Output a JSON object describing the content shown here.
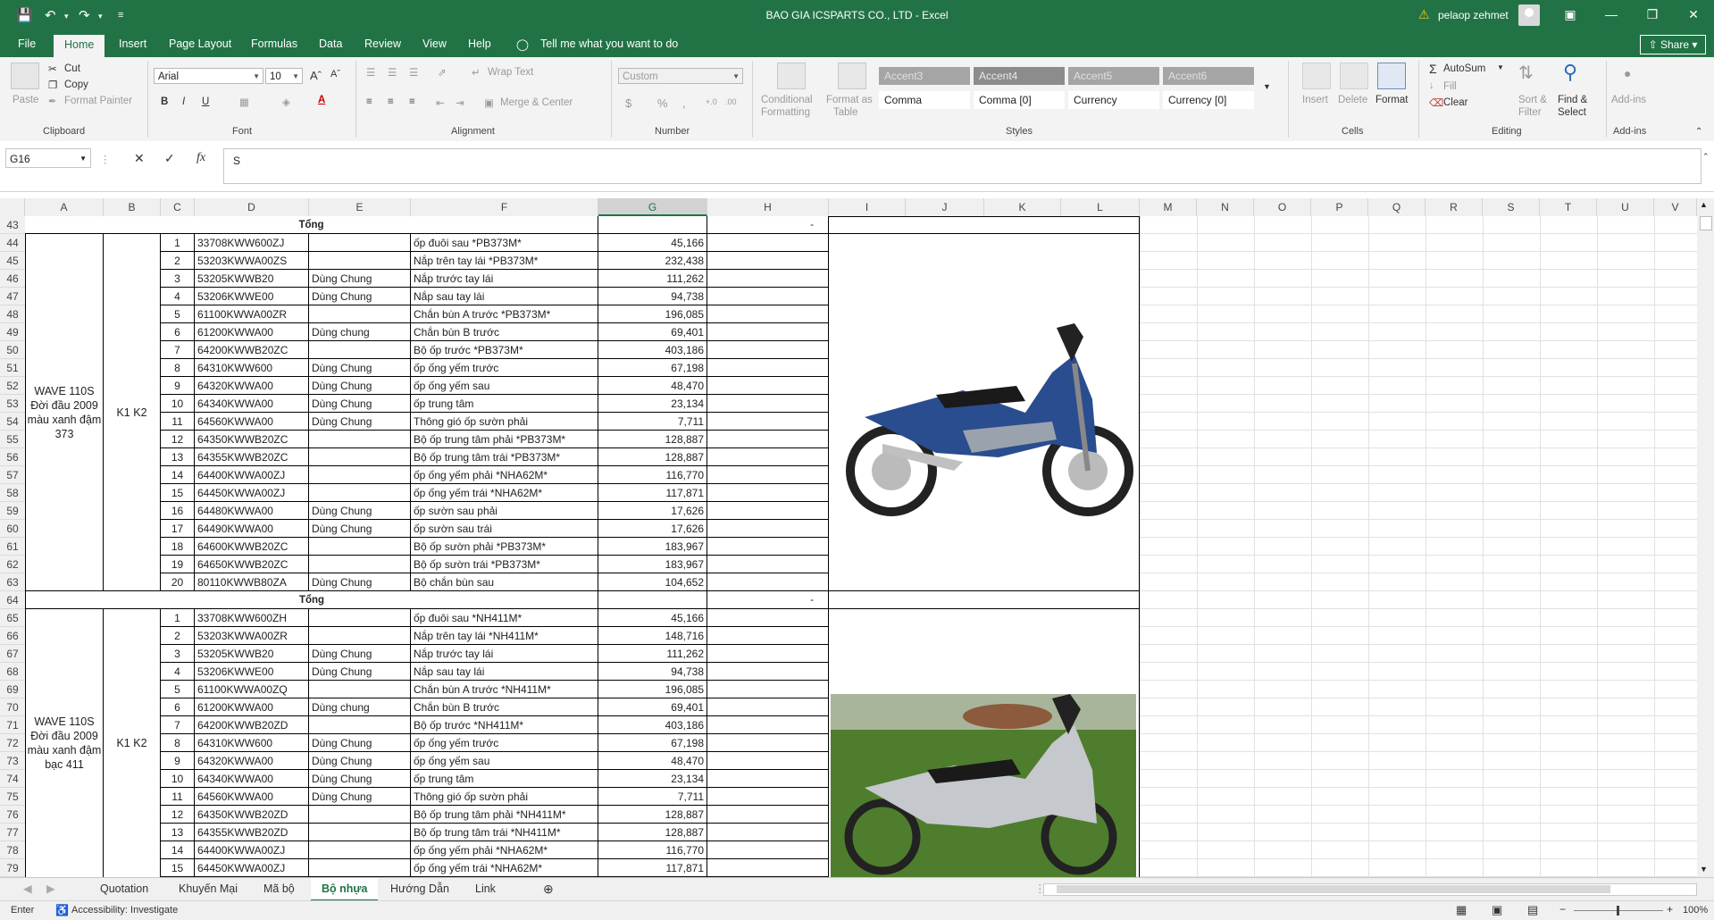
{
  "window": {
    "title": "BAO GIA ICSPARTS CO., LTD  -  Excel",
    "user": "pelaop zehmet"
  },
  "ribbon_tabs": [
    "File",
    "Home",
    "Insert",
    "Page Layout",
    "Formulas",
    "Data",
    "Review",
    "View",
    "Help",
    "Tell me what you want to do"
  ],
  "share_label": "Share",
  "clipboard": {
    "paste": "Paste",
    "cut": "Cut",
    "copy": "Copy",
    "format_painter": "Format Painter",
    "label": "Clipboard"
  },
  "font": {
    "name": "Arial",
    "size": "10",
    "label": "Font"
  },
  "alignment": {
    "wrap": "Wrap Text",
    "merge": "Merge & Center",
    "label": "Alignment"
  },
  "number": {
    "format": "Custom",
    "label": "Number"
  },
  "styles": {
    "cond1": "Conditional",
    "cond2": "Formatting",
    "fmt1": "Format as",
    "fmt2": "Table",
    "cells": [
      "Accent3",
      "Accent4",
      "Accent5",
      "Accent6",
      "Comma",
      "Comma [0]",
      "Currency",
      "Currency [0]"
    ],
    "label": "Styles"
  },
  "cells_group": {
    "insert": "Insert",
    "delete": "Delete",
    "format": "Format",
    "label": "Cells"
  },
  "editing": {
    "autosum": "AutoSum",
    "fill": "Fill",
    "clear": "Clear",
    "sort1": "Sort &",
    "sort2": "Filter",
    "find1": "Find &",
    "find2": "Select",
    "label": "Editing"
  },
  "addins": {
    "btn": "Add-ins",
    "label": "Add-ins"
  },
  "formula_bar": {
    "name_box": "G16",
    "content": "S"
  },
  "columns": [
    "A",
    "B",
    "C",
    "D",
    "E",
    "F",
    "G",
    "H",
    "I",
    "J",
    "K",
    "L",
    "M",
    "N",
    "O",
    "P",
    "Q",
    "R",
    "S",
    "T",
    "U",
    "V"
  ],
  "rows": [
    "43",
    "44",
    "45",
    "46",
    "47",
    "48",
    "49",
    "50",
    "51",
    "52",
    "53",
    "54",
    "55",
    "56",
    "57",
    "58",
    "59",
    "60",
    "61",
    "62",
    "63",
    "64",
    "65",
    "66",
    "67",
    "68",
    "69",
    "70",
    "71",
    "72",
    "73",
    "74",
    "75",
    "76",
    "77",
    "78",
    "79"
  ],
  "total_label": "Tổng",
  "total_dash": "-",
  "block1": {
    "model": "WAVE 110S Đời đầu 2009 màu xanh đậm 373",
    "version": "K1 K2",
    "items": [
      [
        "1",
        "33708KWW600ZJ",
        "",
        "ốp đuôi sau *PB373M*",
        "45,166"
      ],
      [
        "2",
        "53203KWWA00ZS",
        "",
        "Nắp trên tay lái *PB373M*",
        "232,438"
      ],
      [
        "3",
        "53205KWWB20",
        "Dùng Chung",
        "Nắp trước tay lái",
        "111,262"
      ],
      [
        "4",
        "53206KWWE00",
        "Dùng Chung",
        "Nắp sau tay lái",
        "94,738"
      ],
      [
        "5",
        "61100KWWA00ZR",
        "",
        "Chắn bùn A trước *PB373M*",
        "196,085"
      ],
      [
        "6",
        "61200KWWA00",
        "Dùng chung",
        "Chắn bùn B trước",
        "69,401"
      ],
      [
        "7",
        "64200KWWB20ZC",
        "",
        "Bộ ốp trước *PB373M*",
        "403,186"
      ],
      [
        "8",
        "64310KWW600",
        "Dùng Chung",
        "ốp ống yếm trước",
        "67,198"
      ],
      [
        "9",
        "64320KWWA00",
        "Dùng Chung",
        "ốp ống yếm sau",
        "48,470"
      ],
      [
        "10",
        "64340KWWA00",
        "Dùng Chung",
        "ốp trung tâm",
        "23,134"
      ],
      [
        "11",
        "64560KWWA00",
        "Dùng Chung",
        "Thông gió ốp sườn phải",
        "7,711"
      ],
      [
        "12",
        "64350KWWB20ZC",
        "",
        "Bộ ốp trung tâm phải *PB373M*",
        "128,887"
      ],
      [
        "13",
        "64355KWWB20ZC",
        "",
        "Bộ ốp trung tâm trái *PB373M*",
        "128,887"
      ],
      [
        "14",
        "64400KWWA00ZJ",
        "",
        "ốp ống yếm phải *NHA62M*",
        "116,770"
      ],
      [
        "15",
        "64450KWWA00ZJ",
        "",
        "ốp ống yếm trái *NHA62M*",
        "117,871"
      ],
      [
        "16",
        "64480KWWA00",
        "Dùng Chung",
        "ốp sườn sau phải",
        "17,626"
      ],
      [
        "17",
        "64490KWWA00",
        "Dùng Chung",
        "ốp sườn sau trái",
        "17,626"
      ],
      [
        "18",
        "64600KWWB20ZC",
        "",
        "Bộ ốp sườn phải *PB373M*",
        "183,967"
      ],
      [
        "19",
        "64650KWWB20ZC",
        "",
        "Bộ ốp sườn trái *PB373M*",
        "183,967"
      ],
      [
        "20",
        "80110KWWB80ZA",
        "Dùng Chung",
        "Bộ chắn bùn sau",
        "104,652"
      ]
    ]
  },
  "block2": {
    "model": "WAVE 110S Đời đầu 2009 màu xanh đậm bạc 411",
    "version": "K1 K2",
    "items": [
      [
        "1",
        "33708KWW600ZH",
        "",
        "ốp đuôi sau *NH411M*",
        "45,166"
      ],
      [
        "2",
        "53203KWWA00ZR",
        "",
        "Nắp trên tay lái *NH411M*",
        "148,716"
      ],
      [
        "3",
        "53205KWWB20",
        "Dùng Chung",
        "Nắp trước tay lái",
        "111,262"
      ],
      [
        "4",
        "53206KWWE00",
        "Dùng Chung",
        "Nắp sau tay lái",
        "94,738"
      ],
      [
        "5",
        "61100KWWA00ZQ",
        "",
        "Chắn bùn A trước *NH411M*",
        "196,085"
      ],
      [
        "6",
        "61200KWWA00",
        "Dùng chung",
        "Chắn bùn B trước",
        "69,401"
      ],
      [
        "7",
        "64200KWWB20ZD",
        "",
        "Bộ ốp trước *NH411M*",
        "403,186"
      ],
      [
        "8",
        "64310KWW600",
        "Dùng Chung",
        "ốp ống yếm trước",
        "67,198"
      ],
      [
        "9",
        "64320KWWA00",
        "Dùng Chung",
        "ốp ống yếm sau",
        "48,470"
      ],
      [
        "10",
        "64340KWWA00",
        "Dùng Chung",
        "ốp trung tâm",
        "23,134"
      ],
      [
        "11",
        "64560KWWA00",
        "Dùng Chung",
        "Thông gió ốp sườn phải",
        "7,711"
      ],
      [
        "12",
        "64350KWWB20ZD",
        "",
        "Bộ ốp trung tâm phải *NH411M*",
        "128,887"
      ],
      [
        "13",
        "64355KWWB20ZD",
        "",
        "Bộ ốp trung tâm trái *NH411M*",
        "128,887"
      ],
      [
        "14",
        "64400KWWA00ZJ",
        "",
        "ốp ống yếm phải *NHA62M*",
        "116,770"
      ],
      [
        "15",
        "64450KWWA00ZJ",
        "",
        "ốp ống yếm trái *NHA62M*",
        "117,871"
      ]
    ]
  },
  "sheet_tabs": [
    "Quotation",
    "Khuyến Mại",
    "Mã bộ",
    "Bộ nhựa",
    "Hướng Dẫn",
    "Link"
  ],
  "active_sheet": "Bộ nhựa",
  "status": {
    "mode": "Enter",
    "accessibility": "Accessibility: Investigate",
    "zoom": "100%"
  },
  "colors": {
    "excel_green": "#217346",
    "bike1_blue": "#2a4d8f",
    "bike2_silver": "#c5c8cc",
    "grass": "#4f7d2e"
  }
}
